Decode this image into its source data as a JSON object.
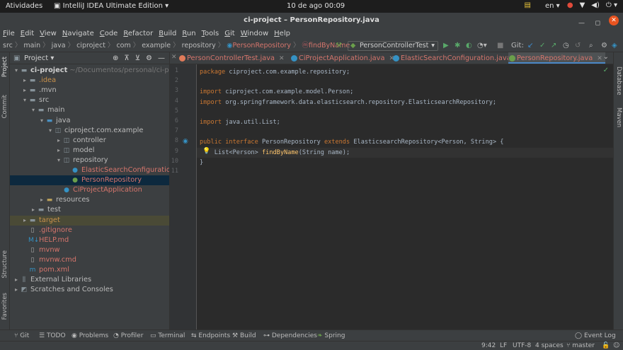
{
  "os_topbar": {
    "activities": "Atividades",
    "app_name": "IntelliJ IDEA Ultimate Edition",
    "clock": "10 de ago  00:09",
    "lang": "en"
  },
  "window": {
    "title": "ci-project – PersonRepository.java"
  },
  "menu": [
    "File",
    "Edit",
    "View",
    "Navigate",
    "Code",
    "Refactor",
    "Build",
    "Run",
    "Tools",
    "Git",
    "Window",
    "Help"
  ],
  "breadcrumbs": [
    "src",
    "main",
    "java",
    "ciproject",
    "com",
    "example",
    "repository",
    "PersonRepository",
    "findByName"
  ],
  "toolbar": {
    "run_config": "PersonControllerTest",
    "git_label": "Git:"
  },
  "project_panel": {
    "title": "Project",
    "tree": [
      {
        "label": "ci-project",
        "extra": "~/Documentos/personal/ci-project",
        "depth": 0,
        "icon": "folder-icon",
        "color": "bold",
        "arrow": "▾"
      },
      {
        "label": ".idea",
        "depth": 1,
        "icon": "folder-icon",
        "color": "orange",
        "arrow": "▸"
      },
      {
        "label": ".mvn",
        "depth": 1,
        "icon": "folder-icon",
        "color": "",
        "arrow": "▸"
      },
      {
        "label": "src",
        "depth": 1,
        "icon": "folder-icon",
        "color": "",
        "arrow": "▾"
      },
      {
        "label": "main",
        "depth": 2,
        "icon": "folder-icon",
        "color": "",
        "arrow": "▾"
      },
      {
        "label": "java",
        "depth": 3,
        "icon": "source-folder-icon",
        "color": "",
        "arrow": "▾"
      },
      {
        "label": "ciproject.com.example",
        "depth": 4,
        "icon": "package-icon",
        "color": "",
        "arrow": "▾"
      },
      {
        "label": "controller",
        "depth": 5,
        "icon": "package-icon",
        "color": "",
        "arrow": "▸"
      },
      {
        "label": "model",
        "depth": 5,
        "icon": "package-icon",
        "color": "",
        "arrow": "▸"
      },
      {
        "label": "repository",
        "depth": 5,
        "icon": "package-icon",
        "color": "",
        "arrow": "▾"
      },
      {
        "label": "ElasticSearchConfiguration",
        "depth": 6,
        "icon": "class-icon",
        "color": "red",
        "arrow": ""
      },
      {
        "label": "PersonRepository",
        "depth": 6,
        "icon": "interface-icon",
        "color": "red",
        "arrow": "",
        "selected": true
      },
      {
        "label": "CiProjectApplication",
        "depth": 5,
        "icon": "class-icon",
        "color": "red",
        "arrow": ""
      },
      {
        "label": "resources",
        "depth": 3,
        "icon": "resources-folder-icon",
        "color": "",
        "arrow": "▸"
      },
      {
        "label": "test",
        "depth": 2,
        "icon": "folder-icon",
        "color": "",
        "arrow": "▸"
      },
      {
        "label": "target",
        "depth": 1,
        "icon": "folder-icon",
        "color": "orange",
        "arrow": "▸",
        "highlighted": true
      },
      {
        "label": ".gitignore",
        "depth": 1,
        "icon": "file-icon",
        "color": "red",
        "arrow": ""
      },
      {
        "label": "HELP.md",
        "depth": 1,
        "icon": "markdown-icon",
        "color": "red",
        "arrow": ""
      },
      {
        "label": "mvnw",
        "depth": 1,
        "icon": "file-icon",
        "color": "red",
        "arrow": ""
      },
      {
        "label": "mvnw.cmd",
        "depth": 1,
        "icon": "file-icon",
        "color": "red",
        "arrow": ""
      },
      {
        "label": "pom.xml",
        "depth": 1,
        "icon": "maven-icon",
        "color": "red",
        "arrow": ""
      },
      {
        "label": "External Libraries",
        "depth": 0,
        "icon": "library-icon",
        "color": "",
        "arrow": "▸"
      },
      {
        "label": "Scratches and Consoles",
        "depth": 0,
        "icon": "scratch-icon",
        "color": "",
        "arrow": "▸"
      }
    ]
  },
  "left_stripe": {
    "project": "Project",
    "commit": "Commit",
    "structure": "Structure",
    "favorites": "Favorites"
  },
  "right_stripe": {
    "database": "Database",
    "maven": "Maven"
  },
  "tabs": [
    {
      "label": "PersonControllerTest.java",
      "active": false
    },
    {
      "label": "CiProjectApplication.java",
      "active": false
    },
    {
      "label": "ElasticSearchConfiguration.java",
      "active": false
    },
    {
      "label": "PersonRepository.java",
      "active": true
    }
  ],
  "code_lines": [
    [
      [
        "kw",
        "package "
      ],
      [
        "",
        "ciproject.com.example.repository;"
      ]
    ],
    [],
    [
      [
        "kw",
        "import "
      ],
      [
        "",
        "ciproject.com.example.model.Person;"
      ]
    ],
    [
      [
        "kw",
        "import "
      ],
      [
        "",
        "org.springframework.data.elasticsearch.repository.ElasticsearchRepository;"
      ]
    ],
    [],
    [
      [
        "kw",
        "import "
      ],
      [
        "",
        "java.util.List;"
      ]
    ],
    [],
    [
      [
        "kw",
        "public interface "
      ],
      [
        "",
        "PersonRepository "
      ],
      [
        "kw",
        "extends "
      ],
      [
        "",
        "ElasticsearchRepository<Person, String> {"
      ]
    ],
    [
      [
        "",
        "    List<Person> "
      ],
      [
        "fn",
        "findByName"
      ],
      [
        "",
        "(String name);"
      ]
    ],
    [
      [
        "",
        "}"
      ]
    ],
    []
  ],
  "bottom_tools": [
    "Git",
    "TODO",
    "Problems",
    "Profiler",
    "Terminal",
    "Endpoints",
    "Build",
    "Dependencies",
    "Spring",
    "Event Log"
  ],
  "status": {
    "position": "9:42",
    "line_sep": "LF",
    "encoding": "UTF-8",
    "indent": "4 spaces",
    "branch": "master"
  }
}
